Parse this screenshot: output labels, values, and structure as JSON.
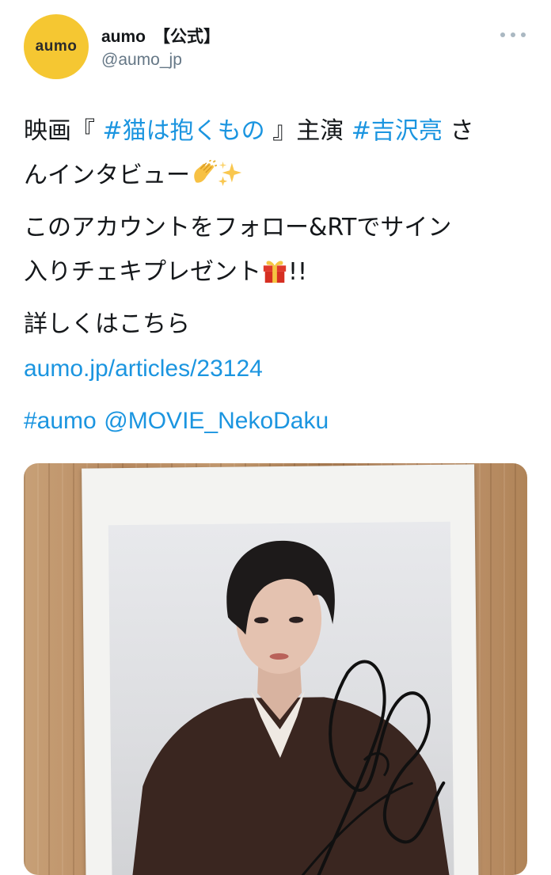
{
  "account": {
    "avatar_text": "aumo",
    "display_name": "aumo",
    "badge": "【公式】",
    "handle": "@aumo_jp"
  },
  "tweet": {
    "line1_prefix": "映画『 ",
    "hashtag_movie": "#猫は抱くもの",
    "line1_mid": " 』主演 ",
    "hashtag_actor": "#吉沢亮",
    "line1_suffix": " さ",
    "line2": "んインタビュー",
    "line3": "このアカウントをフォロー&RTでサイン",
    "line4": "入りチェキプレゼント",
    "line4_suffix": "!!",
    "line5": "詳しくはこちら",
    "link": "aumo.jp/articles/23124",
    "hashtag_aumo": "#aumo",
    "mention": "@MOVIE_NekoDaku"
  },
  "icons": [
    "more-dots-icon",
    "clapping-hands-emoji",
    "sparkles-emoji",
    "gift-emoji"
  ],
  "colors": {
    "avatar_bg": "#f5c732",
    "link": "#1b95e0",
    "handle": "#657786"
  }
}
